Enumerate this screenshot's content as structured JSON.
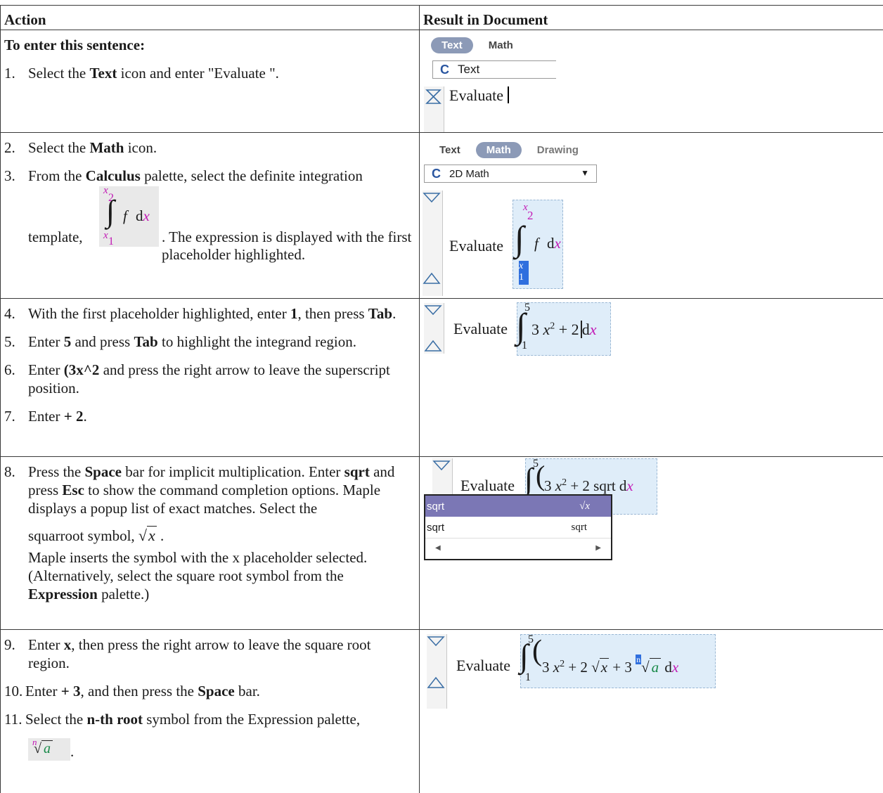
{
  "headers": {
    "action": "Action",
    "result": "Result in Document"
  },
  "row1": {
    "intro": "To enter this sentence:",
    "step1_num": "1.",
    "step1_a": "Select the ",
    "step1_b": "Text",
    "step1_c": " icon and enter \"Evaluate \".",
    "tab_text": "Text",
    "tab_math": "Math",
    "mode": "Text",
    "evaluate": "Evaluate"
  },
  "row2": {
    "step2_num": "2.",
    "step2_a": "Select the ",
    "step2_b": "Math",
    "step2_c": " icon.",
    "step3_num": "3.",
    "step3_a": "From the ",
    "step3_b": "Calculus",
    "step3_c": " palette, select the definite integration",
    "step3_d": "template,",
    "step3_e": ". The expression is displayed with the first placeholder highlighted.",
    "tab_text": "Text",
    "tab_math": "Math",
    "tab_drawing": "Drawing",
    "mode": "2D Math",
    "evaluate": "Evaluate"
  },
  "row3": {
    "s4_num": "4.",
    "s4_a": "With the first placeholder highlighted, enter ",
    "s4_b": "1",
    "s4_c": ", then press ",
    "s4_d": "Tab",
    "s5_num": "5.",
    "s5_a": "Enter ",
    "s5_b": "5",
    "s5_c": " and press ",
    "s5_d": "Tab",
    "s5_e": " to highlight the integrand region.",
    "s6_num": "6.",
    "s6_a": "Enter ",
    "s6_b": "(3x^2",
    "s6_c": " and press the right arrow to leave the superscript position.",
    "s7_num": "7.",
    "s7_a": "Enter ",
    "s7_b": "+ 2",
    "evaluate": "Evaluate"
  },
  "row4": {
    "s8_num": "8.",
    "s8_a": "Press the ",
    "s8_b": "Space",
    "s8_c": " bar for implicit multiplication. Enter ",
    "s8_d": "sqrt",
    "s8_e": " and press ",
    "s8_f": "Esc",
    "s8_g": " to show the command completion options. Maple displays a popup list of exact matches. Select the",
    "s8_h": "squarroot symbol,",
    "s8_i": "Maple inserts the symbol with the x placeholder selected. (Alternatively, select the square root symbol from the ",
    "s8_j": "Expression",
    "s8_k": " palette.)",
    "evaluate": "Evaluate",
    "popup": [
      {
        "name": "sqrt",
        "preview": "√x"
      },
      {
        "name": "sqrt",
        "preview": "sqrt"
      }
    ]
  },
  "row5": {
    "s9_num": "9.",
    "s9_a": "Enter ",
    "s9_b": "x",
    "s9_c": ", then press the right arrow to leave the square root region.",
    "s10_num": "10.",
    "s10_a": "Enter ",
    "s10_b": "+ 3",
    "s10_c": ", and then press the ",
    "s10_d": "Space",
    "s10_e": " bar.",
    "s11_num": "11.",
    "s11_a": "Select the ",
    "s11_b": "n-th root",
    "s11_c": " symbol from the Expression palette,",
    "evaluate": "Evaluate"
  }
}
